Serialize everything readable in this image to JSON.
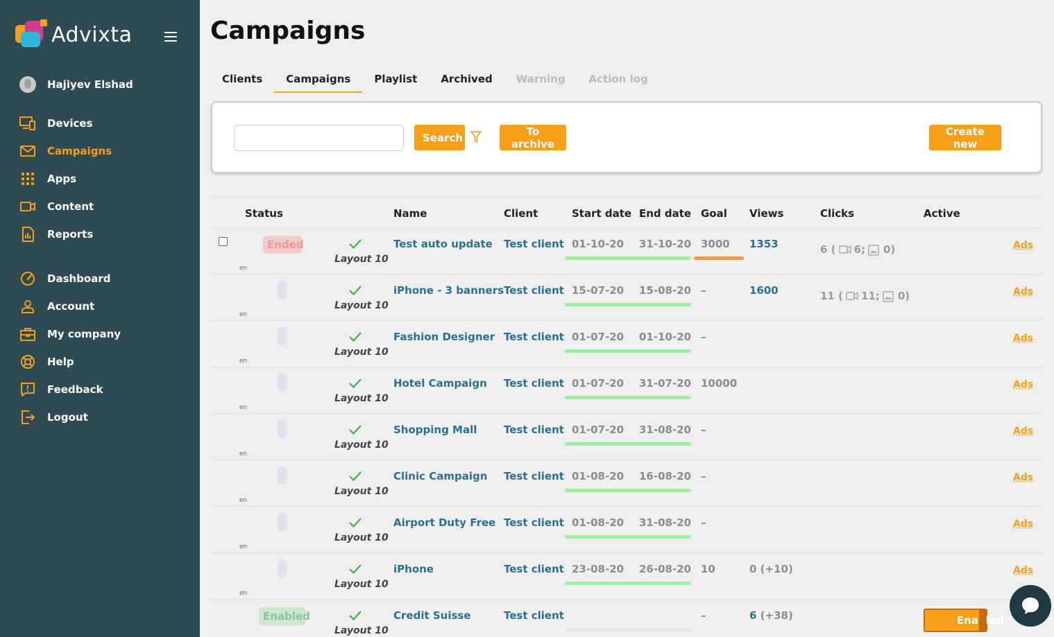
{
  "app": {
    "name": "Advixta"
  },
  "user": {
    "name": "Hajiyev Elshad"
  },
  "nav": {
    "primary": [
      {
        "label": "Devices",
        "icon": "devices-icon"
      },
      {
        "label": "Campaigns",
        "icon": "mail-icon",
        "active": true
      },
      {
        "label": "Apps",
        "icon": "grid-icon"
      },
      {
        "label": "Content",
        "icon": "video-camera-icon"
      },
      {
        "label": "Reports",
        "icon": "report-icon"
      }
    ],
    "secondary": [
      {
        "label": "Dashboard",
        "icon": "speedometer-icon"
      },
      {
        "label": "Account",
        "icon": "user-icon"
      },
      {
        "label": "My company",
        "icon": "briefcase-icon"
      },
      {
        "label": "Help",
        "icon": "lifebuoy-icon"
      },
      {
        "label": "Feedback",
        "icon": "feedback-icon"
      },
      {
        "label": "Logout",
        "icon": "logout-icon"
      }
    ]
  },
  "page": {
    "title": "Campaigns"
  },
  "tabs": [
    {
      "label": "Clients",
      "state": "normal"
    },
    {
      "label": "Campaigns",
      "state": "active"
    },
    {
      "label": "Playlist",
      "state": "normal"
    },
    {
      "label": "Archived",
      "state": "normal"
    },
    {
      "label": "Warning",
      "state": "disabled"
    },
    {
      "label": "Action log",
      "state": "disabled"
    }
  ],
  "toolbar": {
    "search_placeholder": "",
    "search_label": "Search",
    "archive_label": "To archive",
    "create_label": "Create new"
  },
  "table": {
    "headers": {
      "status": "Status",
      "name": "Name",
      "client": "Client",
      "start": "Start date",
      "end": "End date",
      "goal": "Goal",
      "views": "Views",
      "clicks": "Clicks",
      "active": "Active"
    },
    "rows": [
      {
        "status": "Ended",
        "status_type": "ended",
        "checkbox": true,
        "lang": "en",
        "layout": "Layout 10",
        "name": "Test auto update",
        "client": "Test client",
        "start": "01-10-20",
        "end": "31-10-20",
        "date_progress": 1.0,
        "goal": "3000",
        "goal_bar": true,
        "views": "1353",
        "views_delta": "",
        "views_style": "link",
        "clicks": {
          "total": "6",
          "video": "6;",
          "image": "0)"
        },
        "ads": "Ads"
      },
      {
        "status": "",
        "status_type": "blank",
        "checkbox": false,
        "lang": "en",
        "layout": "Layout 10",
        "name": "iPhone - 3 banners",
        "client": "Test client",
        "start": "15-07-20",
        "end": "15-08-20",
        "date_progress": 1.0,
        "goal": "–",
        "goal_bar": false,
        "views": "1600",
        "views_delta": "",
        "views_style": "link",
        "clicks": {
          "total": "11",
          "video": "11;",
          "image": "0)"
        },
        "ads": "Ads"
      },
      {
        "status": "",
        "status_type": "blank",
        "checkbox": false,
        "lang": "en",
        "layout": "Layout 10",
        "name": "Fashion Designer",
        "client": "Test client",
        "start": "01-07-20",
        "end": "01-10-20",
        "date_progress": 1.0,
        "goal": "–",
        "goal_bar": false,
        "views": "",
        "views_delta": "",
        "views_style": "link",
        "clicks": null,
        "ads": "Ads"
      },
      {
        "status": "",
        "status_type": "blank",
        "checkbox": false,
        "lang": "en",
        "layout": "Layout 10",
        "name": "Hotel Campaign",
        "client": "Test client",
        "start": "01-07-20",
        "end": "31-07-20",
        "date_progress": 1.0,
        "goal": "10000",
        "goal_bar": false,
        "views": "",
        "views_delta": "",
        "views_style": "link",
        "clicks": null,
        "ads": "Ads"
      },
      {
        "status": "",
        "status_type": "blank",
        "checkbox": false,
        "lang": "en",
        "layout": "Layout 10",
        "name": "Shopping Mall",
        "client": "Test client",
        "start": "01-07-20",
        "end": "31-08-20",
        "date_progress": 1.0,
        "goal": "–",
        "goal_bar": false,
        "views": "",
        "views_delta": "",
        "views_style": "link",
        "clicks": null,
        "ads": "Ads"
      },
      {
        "status": "",
        "status_type": "blank",
        "checkbox": false,
        "lang": "en",
        "layout": "Layout 10",
        "name": "Clinic Campaign",
        "client": "Test client",
        "start": "01-08-20",
        "end": "16-08-20",
        "date_progress": 1.0,
        "goal": "–",
        "goal_bar": false,
        "views": "",
        "views_delta": "",
        "views_style": "link",
        "clicks": null,
        "ads": "Ads"
      },
      {
        "status": "",
        "status_type": "blank",
        "checkbox": false,
        "lang": "en",
        "layout": "Layout 10",
        "name": "Airport Duty Free",
        "client": "Test client",
        "start": "01-08-20",
        "end": "31-08-20",
        "date_progress": 1.0,
        "goal": "–",
        "goal_bar": false,
        "views": "",
        "views_delta": "",
        "views_style": "link",
        "clicks": null,
        "ads": "Ads"
      },
      {
        "status": "",
        "status_type": "blank",
        "checkbox": false,
        "lang": "en",
        "layout": "Layout 10",
        "name": "iPhone",
        "client": "Test client",
        "start": "23-08-20",
        "end": "26-08-20",
        "date_progress": 1.0,
        "goal": "10",
        "goal_bar": false,
        "views": "0",
        "views_delta": "(+10)",
        "views_style": "grey",
        "clicks": null,
        "ads": "Ads"
      },
      {
        "status": "Enabled",
        "status_type": "enabled",
        "checkbox": false,
        "lang": "",
        "layout": "Layout 10",
        "name": "Credit Suisse",
        "client": "Test client",
        "start": "",
        "end": "",
        "date_progress": 0,
        "goal": "–",
        "goal_bar": false,
        "views": "6",
        "views_delta": "(+38)",
        "views_style": "link",
        "clicks": null,
        "ads": "",
        "toggle": "Enabled"
      }
    ]
  },
  "colors": {
    "accent": "#f6a019",
    "sidebar": "#2e4a52",
    "link": "#2c6f8f",
    "progress": "#9cf0a0"
  }
}
